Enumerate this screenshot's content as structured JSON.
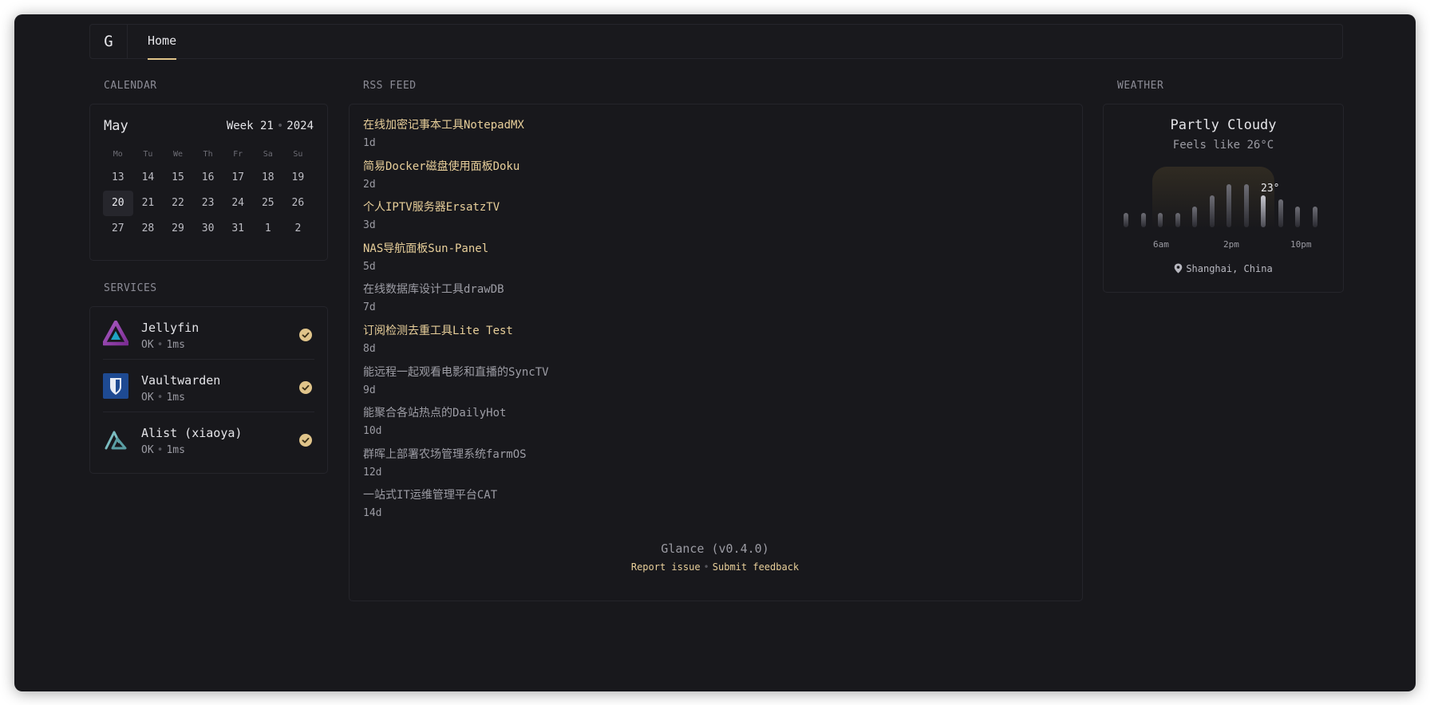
{
  "nav": {
    "logo": "G",
    "home": "Home"
  },
  "calendar": {
    "title": "CALENDAR",
    "month": "May",
    "week_label": "Week 21",
    "year": "2024",
    "weekdays": [
      "Mo",
      "Tu",
      "We",
      "Th",
      "Fr",
      "Sa",
      "Su"
    ],
    "days": [
      "13",
      "14",
      "15",
      "16",
      "17",
      "18",
      "19",
      "20",
      "21",
      "22",
      "23",
      "24",
      "25",
      "26",
      "27",
      "28",
      "29",
      "30",
      "31",
      "1",
      "2"
    ],
    "today": "20"
  },
  "services": {
    "title": "SERVICES",
    "items": [
      {
        "name": "Jellyfin",
        "status": "OK",
        "time": "1ms",
        "icon": "jellyfin-icon"
      },
      {
        "name": "Vaultwarden",
        "status": "OK",
        "time": "1ms",
        "icon": "vaultwarden-icon"
      },
      {
        "name": "Alist (xiaoya)",
        "status": "OK",
        "time": "1ms",
        "icon": "alist-icon"
      }
    ]
  },
  "rss": {
    "title": "RSS FEED",
    "items": [
      {
        "title": "在线加密记事本工具NotepadMX",
        "age": "1d",
        "highlight": true
      },
      {
        "title": "简易Docker磁盘使用面板Doku",
        "age": "2d",
        "highlight": true
      },
      {
        "title": "个人IPTV服务器ErsatzTV",
        "age": "3d",
        "highlight": true
      },
      {
        "title": "NAS导航面板Sun-Panel",
        "age": "5d",
        "highlight": true
      },
      {
        "title": "在线数据库设计工具drawDB",
        "age": "7d",
        "highlight": false
      },
      {
        "title": "订阅检测去重工具Lite Test",
        "age": "8d",
        "highlight": true
      },
      {
        "title": "能远程一起观看电影和直播的SyncTV",
        "age": "9d",
        "highlight": false
      },
      {
        "title": "能聚合各站热点的DailyHot",
        "age": "10d",
        "highlight": false
      },
      {
        "title": "群晖上部署农场管理系统farmOS",
        "age": "12d",
        "highlight": false
      },
      {
        "title": "一站式IT运维管理平台CAT",
        "age": "14d",
        "highlight": false
      }
    ]
  },
  "weather": {
    "title": "WEATHER",
    "condition": "Partly Cloudy",
    "feels_like": "Feels like 26°C",
    "current_temp": "23°",
    "hours": [
      "6am",
      "2pm",
      "10pm"
    ],
    "location": "Shanghai, China",
    "bar_levels": [
      0.22,
      0.22,
      0.22,
      0.22,
      0.33,
      0.5,
      0.67,
      0.67,
      0.5,
      0.44,
      0.33,
      0.33
    ],
    "current_index": 8,
    "accent": "#e0c48a"
  },
  "footer": {
    "app": "Glance",
    "version": "(v0.4.0)",
    "report": "Report issue",
    "feedback": "Submit feedback"
  }
}
